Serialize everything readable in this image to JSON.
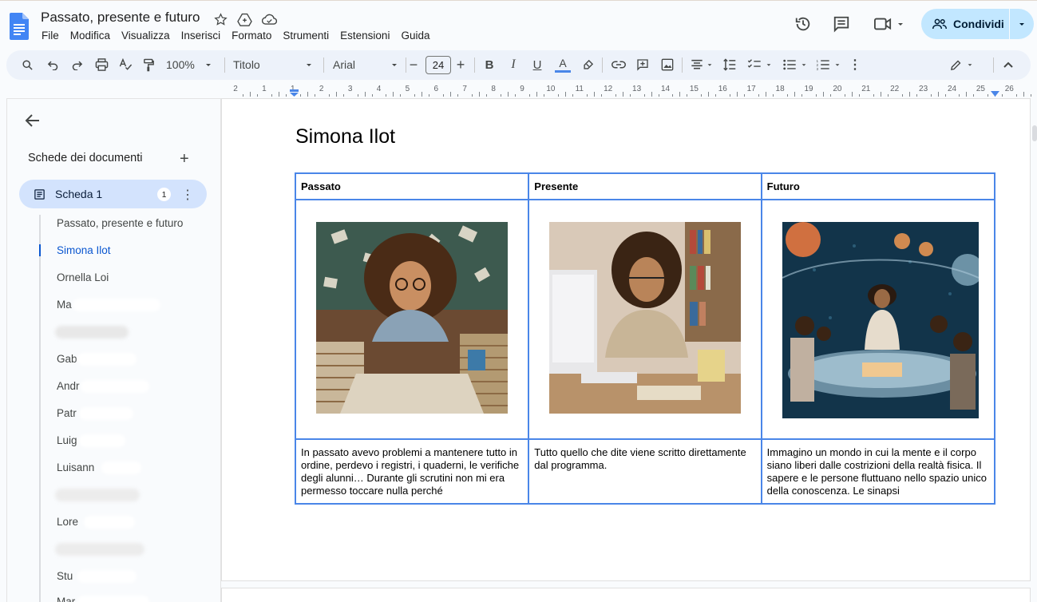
{
  "app": {
    "doc_title": "Passato, presente e futuro",
    "menu": [
      "File",
      "Modifica",
      "Visualizza",
      "Inserisci",
      "Formato",
      "Strumenti",
      "Estensioni",
      "Guida"
    ],
    "share_label": "Condividi"
  },
  "toolbar": {
    "zoom": "100%",
    "style": "Titolo",
    "font": "Arial",
    "font_size": "24"
  },
  "ruler": {
    "numbers": [
      "2",
      "1",
      "1",
      "2",
      "3",
      "4",
      "5",
      "6",
      "7",
      "8",
      "9",
      "10",
      "11",
      "12",
      "13",
      "14",
      "15",
      "16",
      "17",
      "18",
      "19",
      "20",
      "21",
      "22",
      "23",
      "24",
      "25",
      "26"
    ]
  },
  "sidebar": {
    "heading": "Schede dei documenti",
    "tab_label": "Scheda 1",
    "tab_badge": "1",
    "items": [
      "Passato, presente e futuro",
      "Simona Ilot",
      "Ornella Loi",
      "Ma",
      "",
      "Gab",
      "Andr",
      "Patr",
      "Luig",
      "Luisann",
      "",
      "Lore",
      "",
      "Stu",
      "Mar"
    ]
  },
  "document": {
    "heading": "Simona Ilot",
    "table": {
      "headers": [
        "Passato",
        "Presente",
        "Futuro"
      ],
      "texts": [
        "In passato avevo problemi a mantenere tutto in ordine, perdevo i registri, i quaderni, le verifiche degli alunni… Durante gli scrutini non mi era permesso toccare nulla perché",
        "Tutto quello che dite viene scritto direttamente dal programma.",
        "Immagino un mondo in cui la mente e il corpo siano liberi dalle costrizioni della realtà fisica. Il sapere e le persone fluttuano nello spazio unico della conoscenza. Le sinapsi"
      ]
    }
  },
  "colors": {
    "accent": "#0b57d0",
    "share_bg": "#c2e7ff",
    "table_border": "#4a86e8",
    "active_tab_bg": "#d3e3fd"
  }
}
